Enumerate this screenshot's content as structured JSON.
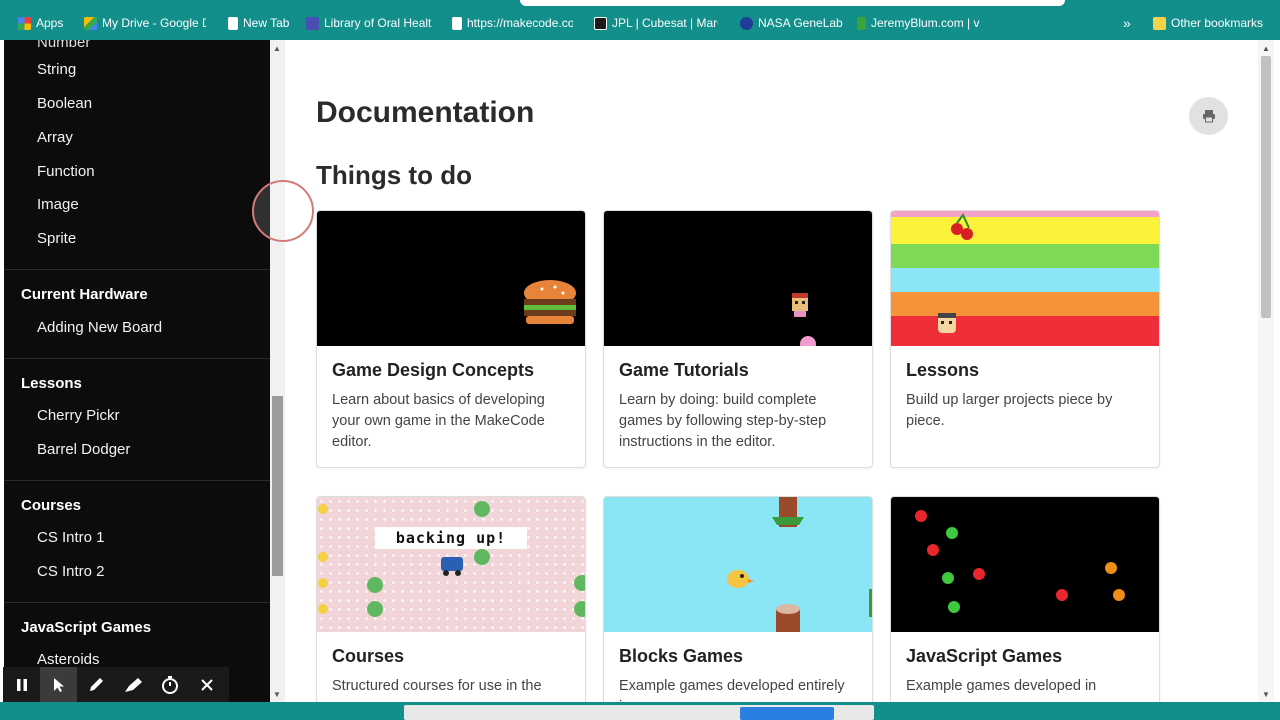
{
  "bookmarks": [
    {
      "label": "Apps",
      "icon": "apps-grid-icon",
      "color": "#e94235"
    },
    {
      "label": "My Drive - Google D",
      "icon": "google-drive-icon",
      "color": "#fbbc04"
    },
    {
      "label": "New Tab",
      "icon": "page-icon",
      "color": "#ffffff"
    },
    {
      "label": "Library of Oral Healt",
      "icon": "library-icon",
      "color": "#4a4fb3"
    },
    {
      "label": "https://makecode.co",
      "icon": "page-icon",
      "color": "#ffffff"
    },
    {
      "label": "JPL | Cubesat | MarC",
      "icon": "jpl-icon",
      "color": "#1b1b1b"
    },
    {
      "label": "NASA GeneLab",
      "icon": "nasa-icon",
      "color": "#1f3c99"
    },
    {
      "label": "JeremyBlum.com | v",
      "icon": "jb-icon",
      "color": "#3aa43a"
    }
  ],
  "bookmarks_overflow": "»",
  "other_bookmarks": "Other bookmarks",
  "sidebar": {
    "cut_item": "Number",
    "group1": [
      "String",
      "Boolean",
      "Array",
      "Function",
      "Image",
      "Sprite"
    ],
    "sections": [
      {
        "title": "Current Hardware",
        "items": [
          "Adding New Board"
        ]
      },
      {
        "title": "Lessons",
        "items": [
          "Cherry Pickr",
          "Barrel Dodger"
        ]
      },
      {
        "title": "Courses",
        "items": [
          "CS Intro 1",
          "CS Intro 2"
        ]
      },
      {
        "title": "JavaScript Games",
        "items": [
          "Asteroids"
        ]
      }
    ]
  },
  "main": {
    "page_title": "Documentation",
    "section_title": "Things to do",
    "print_icon": "print-icon",
    "cards": [
      {
        "title": "Game Design Concepts",
        "desc": "Learn about basics of developing your own game in the MakeCode editor."
      },
      {
        "title": "Game Tutorials",
        "desc": "Learn by doing: build complete games by following step-by-step instructions in the editor."
      },
      {
        "title": "Lessons",
        "desc": "Build up larger projects piece by piece."
      },
      {
        "title": "Courses",
        "desc": "Structured courses for use in the",
        "thumb_text": "backing up!"
      },
      {
        "title": "Blocks Games",
        "desc": "Example games developed entirely in"
      },
      {
        "title": "JavaScript Games",
        "desc": "Example games developed in"
      }
    ]
  },
  "recorder_tools": [
    "pause-icon",
    "pointer-icon",
    "pen-icon",
    "highlighter-icon",
    "timer-icon",
    "close-icon"
  ]
}
